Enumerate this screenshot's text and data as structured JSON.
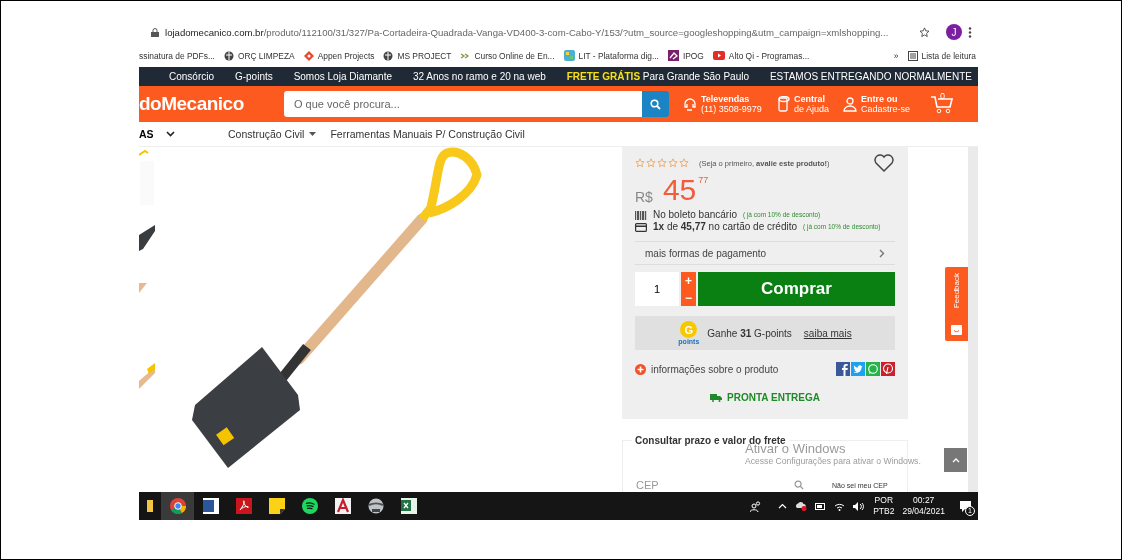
{
  "browser": {
    "url_host": "lojadomecanico.com.br",
    "url_path": "/produto/112100/31/327/Pa-Cortadeira-Quadrada-Vanga-VD400-3-com-Cabo-Y/153/?utm_source=googleshopping&utm_campaign=xmlshopping...",
    "profile_initial": "J",
    "bookmarks": [
      {
        "label": "ssinatura de PDFs...",
        "kind": "none"
      },
      {
        "label": "ORÇ LIMPEZA",
        "kind": "globe"
      },
      {
        "label": "Appen Projects",
        "kind": "diamond"
      },
      {
        "label": "MS PROJECT",
        "kind": "globe"
      },
      {
        "label": "Curso Online de En...",
        "kind": "arrows"
      },
      {
        "label": "LIT - Plataforma dig...",
        "kind": "grid"
      },
      {
        "label": "IPOG",
        "kind": "purple"
      },
      {
        "label": "Alto Qi - Programas...",
        "kind": "video"
      }
    ],
    "overflow": "»",
    "reading_list": "Lista de leitura"
  },
  "top_nav": [
    {
      "label": "Consórcio"
    },
    {
      "label": "G-points"
    },
    {
      "label": "Somos Loja Diamante"
    },
    {
      "label": "32 Anos no ramo e 20 na web"
    },
    {
      "highlight": "FRETE GRÁTIS",
      "label": "Para Grande São Paulo"
    },
    {
      "label": "ESTAMOS ENTREGANDO NORMALMENTE"
    }
  ],
  "header": {
    "logo": "doMecanico",
    "search_placeholder": "O que você procura...",
    "links": [
      {
        "kind": "headset",
        "title": "Televendas",
        "subtitle": "(11) 3508-9979"
      },
      {
        "kind": "phone",
        "title": "Central",
        "subtitle": "de Ajuda"
      },
      {
        "kind": "user",
        "title": "Entre ou",
        "subtitle": "Cadastre-se"
      }
    ],
    "cart_count": "0"
  },
  "categories": {
    "menu_label": "AS",
    "breadcrumbs": [
      {
        "label": "Construção Civil",
        "dropdown": true
      },
      {
        "label": "Ferramentas Manuais P/ Construção Civil",
        "dropdown": false
      }
    ]
  },
  "product": {
    "stars": 0,
    "rating_prompt": "(Seja o primeiro, **avalie este produto!**)",
    "currency": "R$",
    "price_whole": "45",
    "price_cents": "77",
    "payments": [
      {
        "kind": "barcode",
        "text": "No boleto bancário",
        "note": "( já com 10% de desconto)"
      },
      {
        "kind": "card",
        "text": "**1x** de **45,77** no cartão de crédito",
        "note": "( já com 10% de desconto)"
      }
    ],
    "more_payments": "mais formas de pagamento",
    "quantity": "1",
    "increment": "+",
    "decrement": "−",
    "buy_button": "Comprar",
    "gpoints": {
      "badge_letter": "G",
      "badge_caption": "points",
      "text": "Ganhe **31** G-points",
      "link": "saiba mais"
    },
    "info_link": "informações sobre o produto",
    "stock": "PRONTA ENTREGA"
  },
  "shipping": {
    "legend": "Consultar prazo e valor do frete",
    "cep_placeholder": "CEP",
    "help_link": "Não sei meu CEP"
  },
  "feedback": "Feedback",
  "windows_notice": {
    "title": "Ativar o Windows",
    "subtitle": "Acesse Configurações para ativar o Windows."
  },
  "taskbar": {
    "language": "POR",
    "layout": "PTB2",
    "time": "00:27",
    "date": "29/04/2021",
    "notification_count": "1"
  }
}
